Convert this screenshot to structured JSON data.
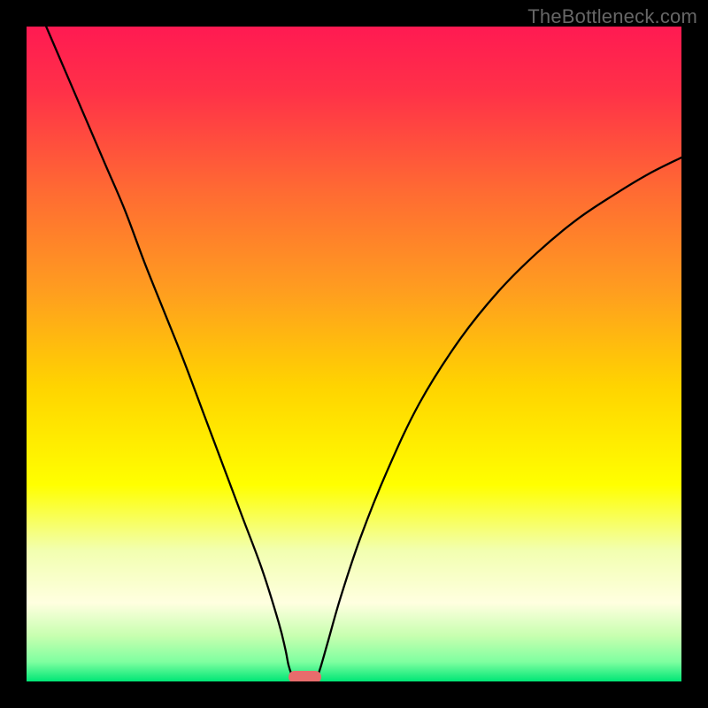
{
  "watermark": "TheBottleneck.com",
  "chart_data": {
    "type": "line",
    "title": "",
    "xlabel": "",
    "ylabel": "",
    "xlim": [
      0,
      100
    ],
    "ylim": [
      0,
      100
    ],
    "gradient_stops": [
      {
        "offset": 0.0,
        "color": "#ff1a52"
      },
      {
        "offset": 0.1,
        "color": "#ff3148"
      },
      {
        "offset": 0.25,
        "color": "#ff6a33"
      },
      {
        "offset": 0.4,
        "color": "#ff9c20"
      },
      {
        "offset": 0.55,
        "color": "#ffd400"
      },
      {
        "offset": 0.7,
        "color": "#ffff00"
      },
      {
        "offset": 0.8,
        "color": "#f2ffb0"
      },
      {
        "offset": 0.88,
        "color": "#ffffe0"
      },
      {
        "offset": 0.93,
        "color": "#c8ffb0"
      },
      {
        "offset": 0.97,
        "color": "#7fffa0"
      },
      {
        "offset": 1.0,
        "color": "#00e676"
      }
    ],
    "series": [
      {
        "name": "left-curve",
        "x": [
          3,
          6,
          9,
          12,
          15,
          18,
          21,
          24,
          27,
          30,
          33,
          36,
          38.5,
          39.5,
          40,
          40.5,
          41
        ],
        "y": [
          100,
          93,
          86,
          79,
          72,
          64,
          56.5,
          49,
          41,
          33,
          25,
          17,
          9,
          5,
          2.5,
          1,
          0
        ]
      },
      {
        "name": "right-curve",
        "x": [
          44,
          44.5,
          45,
          46,
          48,
          51,
          55,
          60,
          66,
          72,
          78,
          84,
          90,
          95,
          100
        ],
        "y": [
          0,
          1,
          2.5,
          6,
          13,
          22,
          32,
          42.5,
          52,
          59.5,
          65.5,
          70.5,
          74.5,
          77.5,
          80
        ]
      }
    ],
    "marker": {
      "name": "bottom-pill",
      "x_center": 42.5,
      "width": 5,
      "color": "#e86c6c"
    }
  }
}
